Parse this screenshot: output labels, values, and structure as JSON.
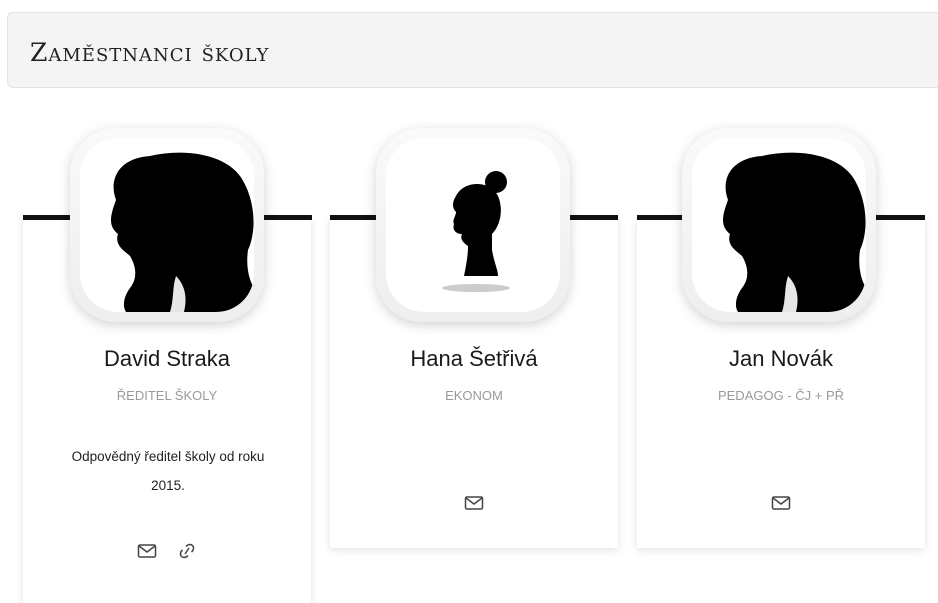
{
  "header": {
    "title": "Zaměstnanci školy"
  },
  "staff": [
    {
      "name": "David Straka",
      "role": "Ředitel školy",
      "description": "Odpovědný ředitel školy od roku 2015.",
      "icons": [
        "mail-icon",
        "link-icon"
      ]
    },
    {
      "name": "Hana Šetřivá",
      "role": "Ekonom",
      "description": "",
      "icons": [
        "mail-icon"
      ]
    },
    {
      "name": "Jan Novák",
      "role": "Pedagog - ČJ + PŘ",
      "description": "",
      "icons": [
        "mail-icon"
      ]
    }
  ]
}
